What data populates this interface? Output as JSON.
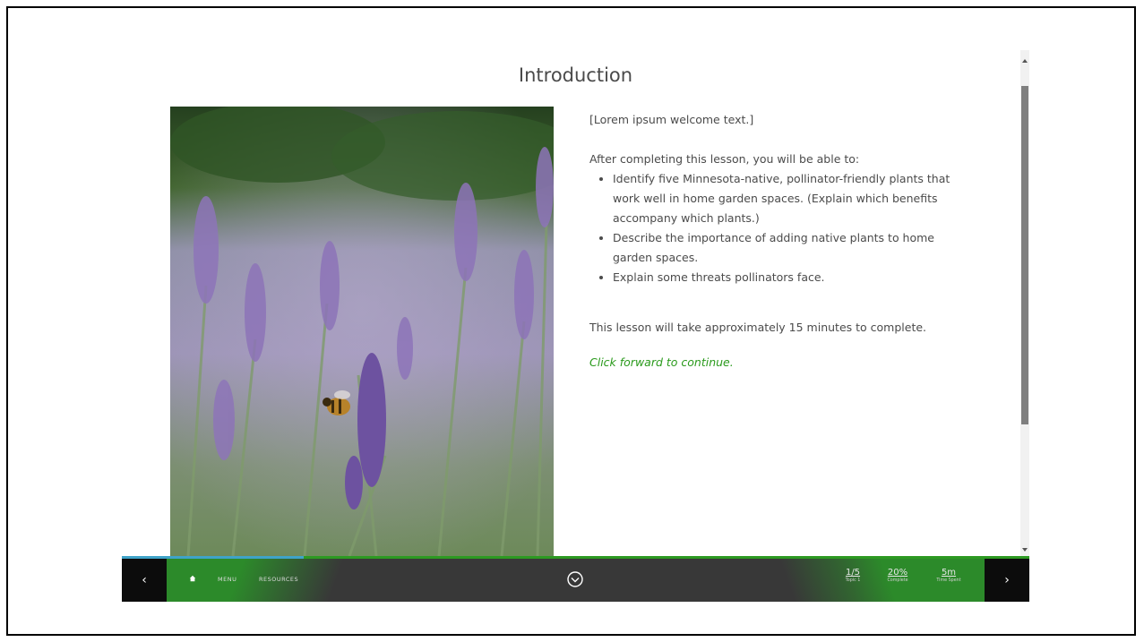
{
  "page": {
    "title": "Introduction"
  },
  "image": {
    "description_icon": "lavender-bee-photo"
  },
  "text": {
    "welcome": "[Lorem ipsum welcome text.]",
    "objectives_intro": "After completing this lesson, you will be able to:",
    "objectives": [
      "Identify five Minnesota-native, pollinator-friendly plants that work well in home garden spaces. (Explain which benefits accompany which plants.)",
      "Describe the importance of adding native plants to home garden spaces.",
      "Explain some threats pollinators face."
    ],
    "duration": "This lesson will take approximately 15 minutes to complete.",
    "cta": "Click forward to continue."
  },
  "navbar": {
    "prev_label": "‹",
    "next_label": "›",
    "menu_label": "MENU",
    "resources_label": "RESOURCES",
    "progress_fraction": 0.2,
    "stats": {
      "topic_value": "1/5",
      "topic_label": "Topic 1",
      "complete_value": "20%",
      "complete_label": "Complete",
      "time_value": "5m",
      "time_label": "Time Spent"
    }
  },
  "colors": {
    "accent_green": "#2a9a1c",
    "progress_blue": "#3fa3c8",
    "nav_dark": "#383838"
  }
}
